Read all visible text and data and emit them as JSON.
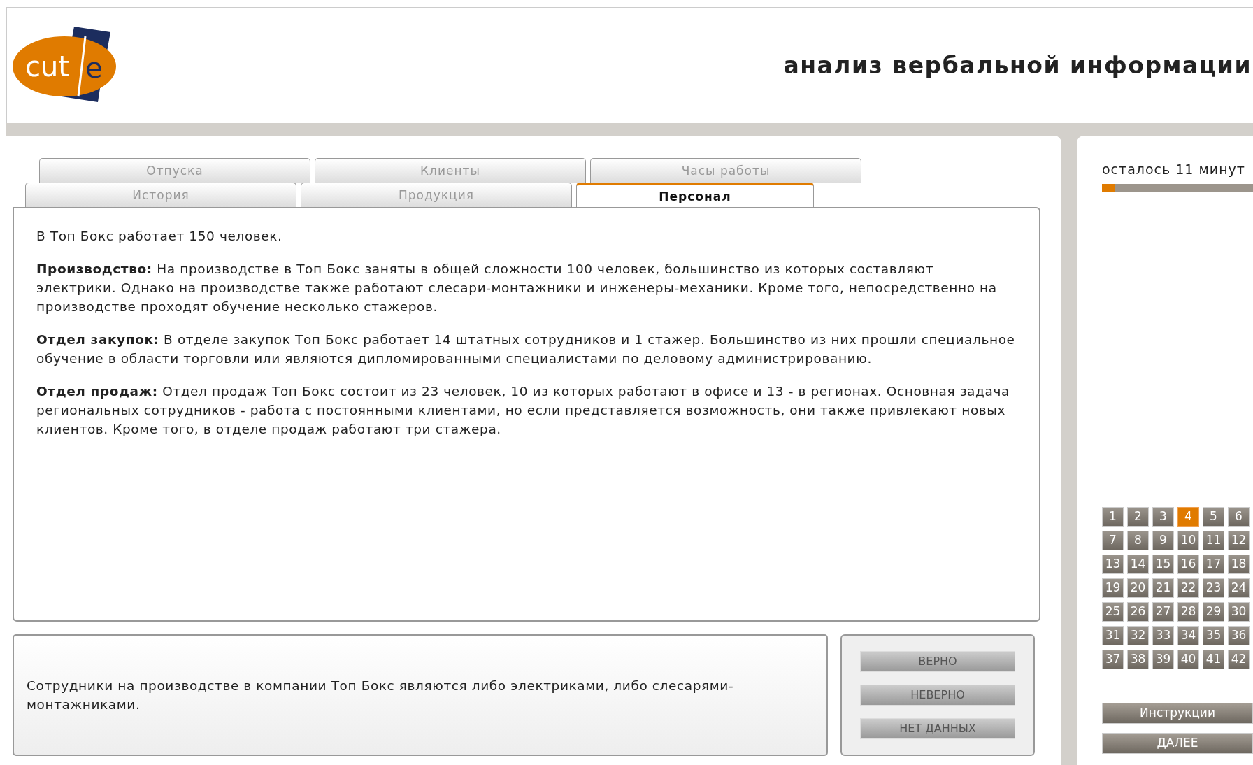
{
  "header": {
    "logo": {
      "left": "cut",
      "right": "e"
    },
    "title": "анализ вербальной информации"
  },
  "tab_rows": [
    [
      {
        "label": "Отпуска",
        "selected": false
      },
      {
        "label": "Клиенты",
        "selected": false
      },
      {
        "label": "Часы работы",
        "selected": false
      }
    ],
    [
      {
        "label": "История",
        "selected": false
      },
      {
        "label": "Продукция",
        "selected": false
      },
      {
        "label": "Персонал",
        "selected": true
      }
    ]
  ],
  "content": [
    "В Топ Бокс работает 150 человек.",
    "**Производство:** На производстве в Топ Бокс заняты в общей сложности 100 человек, большинство из которых составляют электрики. Однако на производстве также работают слесари-монтажники и инженеры-механики. Кроме того, непосредственно на производстве проходят обучение несколько стажеров.",
    "**Отдел закупок:** В отделе закупок Топ Бокс работает 14 штатных сотрудников и 1 стажер. Большинство из них прошли специальное обучение в области торговли или являются дипломированными специалистами по деловому администрированию.",
    "**Отдел продаж:** Отдел продаж Топ Бокс состоит из 23 человек, 10 из которых работают в офисе и 13 - в регионах. Основная задача региональных сотрудников - работа с постоянными клиентами, но если представляется возможность, они также привлекают новых клиентов. Кроме того, в отделе продаж работают три стажера."
  ],
  "statement": "Сотрудники на производстве в компании Топ Бокс являются либо электриками, либо слесарями-монтажниками.",
  "answers": [
    "ВЕРНО",
    "НЕВЕРНО",
    "НЕТ ДАННЫХ"
  ],
  "timer": {
    "text": "осталось 11 минут",
    "level": 0.09
  },
  "questions": [
    {
      "label": "1",
      "selected": false
    },
    {
      "label": "2",
      "selected": false
    },
    {
      "label": "3",
      "selected": false
    },
    {
      "label": "4",
      "selected": true
    },
    {
      "label": "5",
      "selected": false
    },
    {
      "label": "6",
      "selected": false
    },
    {
      "label": "7",
      "selected": false
    },
    {
      "label": "8",
      "selected": false
    },
    {
      "label": "9",
      "selected": false
    },
    {
      "label": "10",
      "selected": false
    },
    {
      "label": "11",
      "selected": false
    },
    {
      "label": "12",
      "selected": false
    },
    {
      "label": "13",
      "selected": false
    },
    {
      "label": "14",
      "selected": false
    },
    {
      "label": "15",
      "selected": false
    },
    {
      "label": "16",
      "selected": false
    },
    {
      "label": "17",
      "selected": false
    },
    {
      "label": "18",
      "selected": false
    },
    {
      "label": "19",
      "selected": false
    },
    {
      "label": "20",
      "selected": false
    },
    {
      "label": "21",
      "selected": false
    },
    {
      "label": "22",
      "selected": false
    },
    {
      "label": "23",
      "selected": false
    },
    {
      "label": "24",
      "selected": false
    },
    {
      "label": "25",
      "selected": false
    },
    {
      "label": "26",
      "selected": false
    },
    {
      "label": "27",
      "selected": false
    },
    {
      "label": "28",
      "selected": false
    },
    {
      "label": "29",
      "selected": false
    },
    {
      "label": "30",
      "selected": false
    },
    {
      "label": "31",
      "selected": false
    },
    {
      "label": "32",
      "selected": false
    },
    {
      "label": "33",
      "selected": false
    },
    {
      "label": "34",
      "selected": false
    },
    {
      "label": "35",
      "selected": false
    },
    {
      "label": "36",
      "selected": false
    },
    {
      "label": "37",
      "selected": false
    },
    {
      "label": "38",
      "selected": false
    },
    {
      "label": "39",
      "selected": false
    },
    {
      "label": "40",
      "selected": false
    },
    {
      "label": "41",
      "selected": false
    },
    {
      "label": "42",
      "selected": false
    }
  ],
  "nav_buttons": [
    "Инструкции",
    "ДАЛЕЕ"
  ]
}
